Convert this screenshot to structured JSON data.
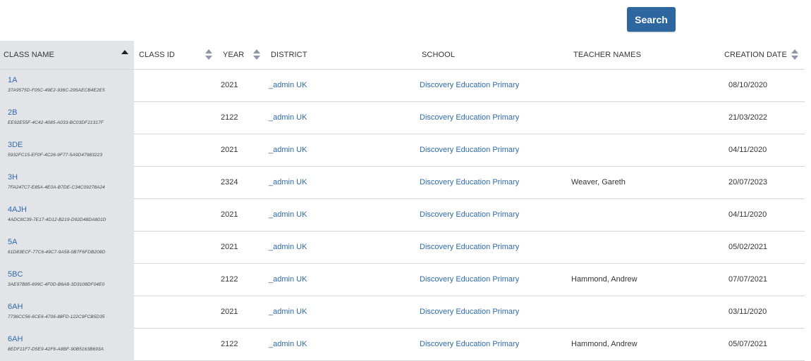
{
  "search": {
    "label": "Search"
  },
  "columns": {
    "class_name": "CLASS NAME",
    "class_id": "CLASS ID",
    "year": "YEAR",
    "district": "DISTRICT",
    "school": "SCHOOL",
    "teacher_names": "TEACHER NAMES",
    "creation_date": "CREATION DATE"
  },
  "rows": [
    {
      "class_name": "1A",
      "class_id": "37A9575D-F05C-49E2-936C-295AECB4E2E5",
      "year": "2021",
      "district": "_admin UK",
      "school": "Discovery Education Primary",
      "teacher": "",
      "created": "08/10/2020"
    },
    {
      "class_name": "2B",
      "class_id": "EE92E55F-4C42-4085-A033-BC03DF21317F",
      "year": "2122",
      "district": "_admin UK",
      "school": "Discovery Education Primary",
      "teacher": "",
      "created": "21/03/2022"
    },
    {
      "class_name": "3DE",
      "class_id": "5932FC15-EF0F-4C26-9F77-5A9D47983223",
      "year": "2021",
      "district": "_admin UK",
      "school": "Discovery Education Primary",
      "teacher": "",
      "created": "04/11/2020"
    },
    {
      "class_name": "3H",
      "class_id": "7FA247C7-E85A-4E0A-B7DE-C34C09278A24",
      "year": "2324",
      "district": "_admin UK",
      "school": "Discovery Education Primary",
      "teacher": "Weaver, Gareth",
      "created": "20/07/2023"
    },
    {
      "class_name": "4AJH",
      "class_id": "4ADC8C39-7E17-4D12-B219-D92D48DA801D",
      "year": "2021",
      "district": "_admin UK",
      "school": "Discovery Education Primary",
      "teacher": "",
      "created": "04/11/2020"
    },
    {
      "class_name": "5A",
      "class_id": "61D83ECF-77C6-49C7-9A58-0B7F6FDB208D",
      "year": "2021",
      "district": "_admin UK",
      "school": "Discovery Education Primary",
      "teacher": "",
      "created": "05/02/2021"
    },
    {
      "class_name": "5BC",
      "class_id": "3AE97B85-699C-4F0D-B6A8-3D3108DF04E0",
      "year": "2122",
      "district": "_admin UK",
      "school": "Discovery Education Primary",
      "teacher": "Hammond, Andrew",
      "created": "07/07/2021"
    },
    {
      "class_name": "6AH",
      "class_id": "7736CC56-6CE6-4706-88FD-122C9FCB5D35",
      "year": "2021",
      "district": "_admin UK",
      "school": "Discovery Education Primary",
      "teacher": "",
      "created": "03/11/2020"
    },
    {
      "class_name": "6AH",
      "class_id": "8EDF11F7-D5E9-42F6-A8BF-90B5163B693A",
      "year": "2122",
      "district": "_admin UK",
      "school": "Discovery Education Primary",
      "teacher": "Hammond, Andrew",
      "created": "05/07/2021"
    }
  ]
}
